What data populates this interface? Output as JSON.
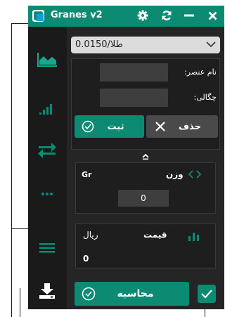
{
  "titlebar": {
    "title": "Granes v2",
    "icons": [
      "app-logo-icon",
      "gear-icon",
      "refresh-icon",
      "minimize-icon",
      "close-icon"
    ]
  },
  "sidebar": {
    "icons": [
      "area-chart-icon",
      "signal-bars-icon",
      "swap-arrows-icon",
      "more-dots-icon",
      "menu-lines-icon",
      "download-icon"
    ]
  },
  "selector": {
    "value": "طلا/0.0150"
  },
  "form": {
    "name_label": "نام عنصر:",
    "name_value": "",
    "density_label": "چگالی:",
    "density_value": "",
    "save_label": "ثبت",
    "delete_label": "حذف"
  },
  "weight": {
    "label": "وزن",
    "unit": "Gr",
    "value": "0"
  },
  "price": {
    "label": "قیمت",
    "unit": "ریال",
    "value": "0"
  },
  "calculate": {
    "label": "محاسبه"
  },
  "colors": {
    "accent": "#0c8a72",
    "panel": "#1e1e1e",
    "window": "#252525",
    "sidebar": "#1a1a1a"
  }
}
